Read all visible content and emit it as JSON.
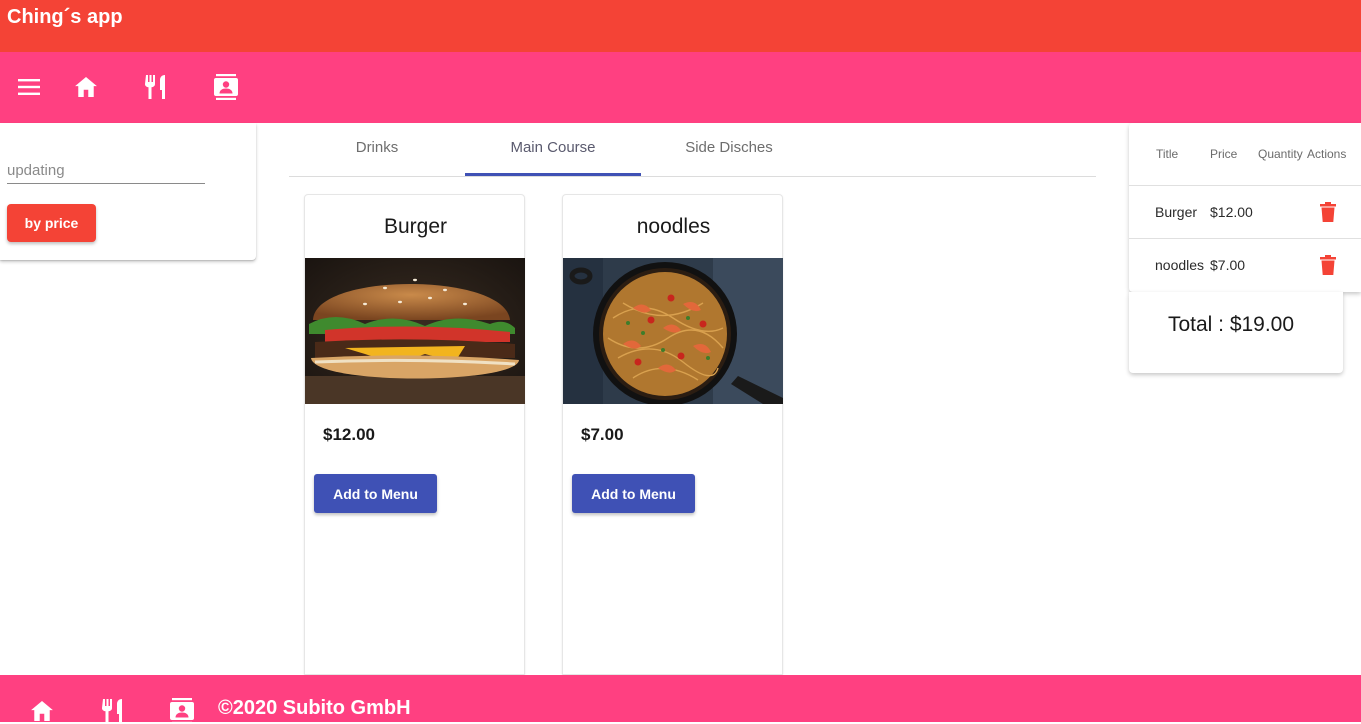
{
  "app": {
    "title": "Ching´s app"
  },
  "navbar": {
    "icons": [
      "menu-icon",
      "home-icon",
      "restaurant-icon",
      "contacts-icon"
    ]
  },
  "filter": {
    "input_value": "updating",
    "button_label": "by price"
  },
  "tabs": [
    {
      "label": "Drinks",
      "active": false
    },
    {
      "label": "Main Course",
      "active": true
    },
    {
      "label": "Side Disches",
      "active": false
    }
  ],
  "products": [
    {
      "name": "Burger",
      "price": "$12.00",
      "button_label": "Add to Menu",
      "image": "burger-photo"
    },
    {
      "name": "noodles",
      "price": "$7.00",
      "button_label": "Add to Menu",
      "image": "noodles-photo"
    }
  ],
  "cart": {
    "headers": {
      "title": "Title",
      "price": "Price",
      "quantity": "Quantity",
      "actions": "Actions"
    },
    "rows": [
      {
        "title": "Burger",
        "price": "$12.00",
        "action_icon": "delete-icon"
      },
      {
        "title": "noodles",
        "price": "$7.00",
        "action_icon": "delete-icon"
      }
    ],
    "total": "Total : $19.00"
  },
  "footer": {
    "icons": [
      "home-icon",
      "restaurant-icon",
      "contacts-icon"
    ],
    "copyright": "©2020 Subito GmbH"
  },
  "colors": {
    "title_bar": "#f44336",
    "nav_bar": "#ff4081",
    "primary": "#3f51b5",
    "accent": "#f44336"
  }
}
